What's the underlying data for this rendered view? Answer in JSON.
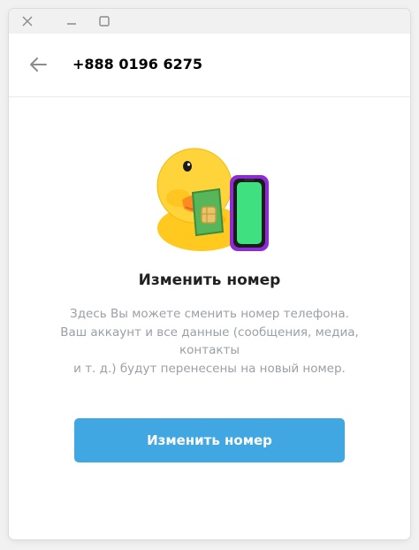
{
  "window": {
    "controls": [
      "close-icon",
      "minimize-icon",
      "maximize-icon"
    ]
  },
  "header": {
    "back_icon": "arrow-left-icon",
    "phone": "+888 0196 6275"
  },
  "main": {
    "sticker": "duck-with-sim-card-and-phone",
    "title": "Изменить номер",
    "description_lines": [
      "Здесь Вы можете сменить номер телефона.",
      "Ваш аккаунт и все данные (сообщения, медиа,",
      "контакты",
      "и т. д.) будут перенесены на новый номер."
    ],
    "button_label": "Изменить номер"
  },
  "colors": {
    "accent": "#40a7e3",
    "text_primary": "#000000",
    "text_secondary": "#9aa0a6",
    "duck_yellow": "#ffd43b",
    "sim_green": "#5cb85c",
    "phone_purple": "#8e2bd6",
    "phone_screen": "#3fe07f"
  }
}
